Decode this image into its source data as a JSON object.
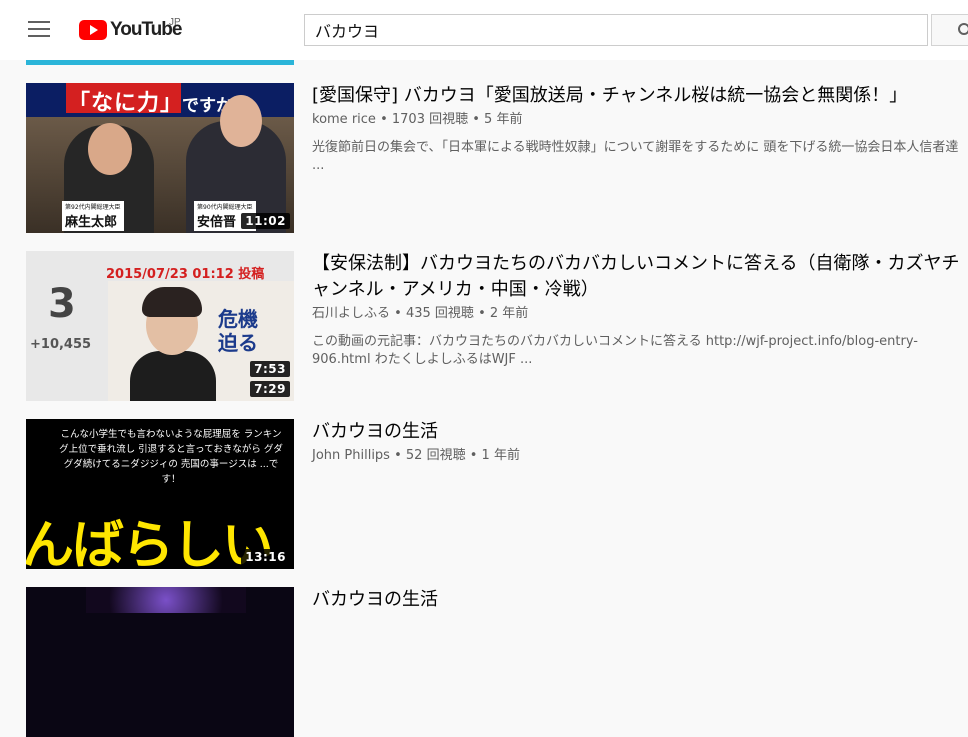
{
  "header": {
    "logo_text": "YouTube",
    "logo_region": "JP",
    "search_value": "バカウヨ"
  },
  "results": [
    {
      "title": "[愛国保守] バカウヨ「愛国放送局・チャンネル桜は統一協会と無関係！」",
      "channel": "kome rice",
      "views": "1703 回視聴",
      "age": "5 年前",
      "description": "光復節前日の集会で、「日本軍による戦時性奴隷」について謝罪をするために 頭を下げる統一協会日本人信者達 ...",
      "duration": "11:02",
      "thumb": {
        "banner": "「なに力」",
        "banner2": "ですか?",
        "caption_left_small": "第92代内閣総理大臣",
        "caption_left": "麻生太郎",
        "caption_right_small": "第90代内閣総理大臣",
        "caption_right": "安倍晋"
      }
    },
    {
      "title": "【安保法制】バカウヨたちのバカバカしいコメントに答える（自衛隊・カズヤチャンネル・アメリカ・中国・冷戦）",
      "channel": "石川よしふる",
      "views": "435 回視聴",
      "age": "2 年前",
      "description": "この動画の元記事：バカウヨたちのバカバカしいコメントに答える http://wjf-project.info/blog-entry-906.html わたくしよしふるはWJF ...",
      "duration": "7:29",
      "thumb": {
        "date": "2015/07/23 01:12 投稿",
        "big": "3",
        "small": "+10,455",
        "kanji": "危機迫る",
        "inner_duration": "7:53"
      }
    },
    {
      "title": "バカウヨの生活",
      "channel": "John Phillips",
      "views": "52 回視聴",
      "age": "1 年前",
      "duration": "13:16",
      "thumb": {
        "text": "こんな小学生でも言わないような屁理屈を ランキング上位で垂れ流し 引退すると言っておきながら グダグダ続けてるニダジジィの 売国の亊ージスは ...です！",
        "big": "んばらしい"
      }
    },
    {
      "title": "バカウヨの生活"
    }
  ],
  "separator": "•"
}
